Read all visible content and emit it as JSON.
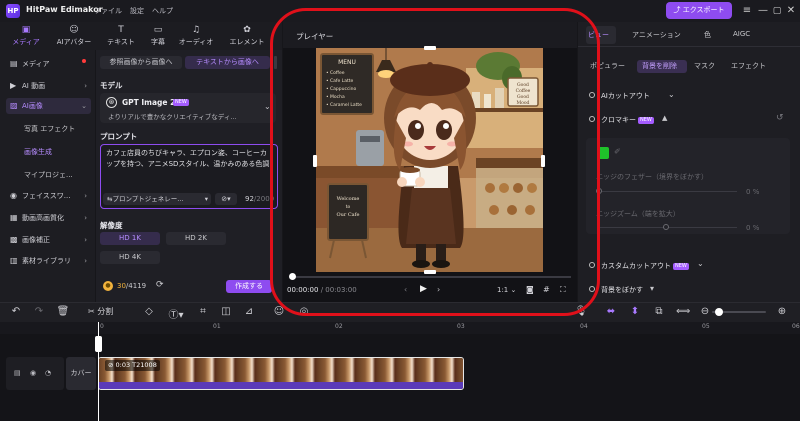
{
  "app": {
    "title": "HitPaw Edimakor",
    "menu": [
      "ファイル",
      "設定",
      "ヘルプ"
    ],
    "export_label": "エクスポート",
    "window_controls": [
      "≡",
      "—",
      "▢",
      "✕"
    ]
  },
  "toolbar": {
    "tabs": [
      {
        "label": "メディア",
        "icon": "media-icon",
        "glyph": "▣"
      },
      {
        "label": "AIアバター",
        "icon": "avatar-icon",
        "glyph": "☺"
      },
      {
        "label": "テキスト",
        "icon": "text-icon",
        "glyph": "T"
      },
      {
        "label": "字幕",
        "icon": "subtitle-icon",
        "glyph": "▭"
      },
      {
        "label": "オーディオ",
        "icon": "audio-icon",
        "glyph": "♫"
      },
      {
        "label": "エレメント",
        "icon": "element-icon",
        "glyph": "✿"
      }
    ]
  },
  "sidebar": {
    "items": [
      {
        "label": "メディア",
        "icon": "folder-icon",
        "glyph": "▤",
        "chevron": ""
      },
      {
        "label": "AI 動画",
        "icon": "ai-video-icon",
        "glyph": "▶",
        "chevron": "›"
      },
      {
        "label": "AI画像",
        "icon": "ai-image-icon",
        "glyph": "▨",
        "chevron": "⌄"
      },
      {
        "label": "フェイススワ...",
        "icon": "face-swap-icon",
        "glyph": "◉",
        "chevron": "›"
      },
      {
        "label": "動画高画質化",
        "icon": "enhance-icon",
        "glyph": "▦",
        "chevron": "›"
      },
      {
        "label": "画像補正",
        "icon": "image-fix-icon",
        "glyph": "▩",
        "chevron": "›"
      },
      {
        "label": "素材ライブラリ",
        "icon": "library-icon",
        "glyph": "▥",
        "chevron": "›"
      }
    ],
    "sub_items": [
      "写真 エフェクト",
      "画像生成",
      "マイプロジェ..."
    ]
  },
  "panel": {
    "mode_tabs": [
      "参照画像から画像へ",
      "テキストから画像へ"
    ],
    "model_title": "モデル",
    "model_name": "GPT Image 2",
    "model_badge": "NEW",
    "model_desc": "よりリアルで豊かなクリエイティブなディ...",
    "prompt_title": "プロンプト",
    "prompt_text": "カフェ店員のちびキャラ、エプロン姿、コーヒーカップを持つ、アニメSDスタイル、温かみのある色調",
    "prompt_tool": "プロンプトジェネレー...",
    "prompt_count": "92",
    "prompt_max": "/2000",
    "resolution_title": "解像度",
    "resolutions": [
      "HD 1K",
      "HD 2K",
      "HD 4K"
    ],
    "credits_used": "30",
    "credits_total": "/4119",
    "create_label": "作成する"
  },
  "player": {
    "title": "プレイヤー",
    "time_current": "00:00:00",
    "time_total": "/ 00:03:00",
    "zoom": "1:1",
    "image": {
      "menu_title": "MENU",
      "menu_items": [
        "Coffee",
        "Cafe Latte",
        "Cappuccino",
        "Mocha",
        "Caramel Latte"
      ],
      "welcome_text": [
        "Welcome",
        "to",
        "Our Cafe"
      ],
      "side_sign": [
        "Good",
        "Coffee",
        "Good",
        "Mood"
      ]
    }
  },
  "rpanel": {
    "tabs": [
      "ビュー",
      "アニメーション",
      "色",
      "AIGC"
    ],
    "sub_tabs": [
      "ポピュラー",
      "背景を削除",
      "マスク",
      "エフェクト"
    ],
    "ai_cutout": "AIカットアウト",
    "chroma": "クロマキー",
    "chroma_badge": "NEW",
    "edge_feather": "エッジのフェザー（境界をぼかす）",
    "edge_feather_value": "0",
    "edge_zoom": "エッジズーム（端を拡大）",
    "edge_zoom_value": "0",
    "custom_cutout": "カスタムカットアウト",
    "custom_badge": "NEW",
    "blur_bg": "背景をぼかす"
  },
  "timeline": {
    "split_label": "分割",
    "ruler_labels": [
      "0",
      "01",
      "02",
      "03",
      "04",
      "05",
      "06"
    ],
    "cover_label": "カバー",
    "clip_label": "0:03 T21008"
  },
  "colors": {
    "accent": "#8e4cf0",
    "highlight": "#e0101a"
  }
}
